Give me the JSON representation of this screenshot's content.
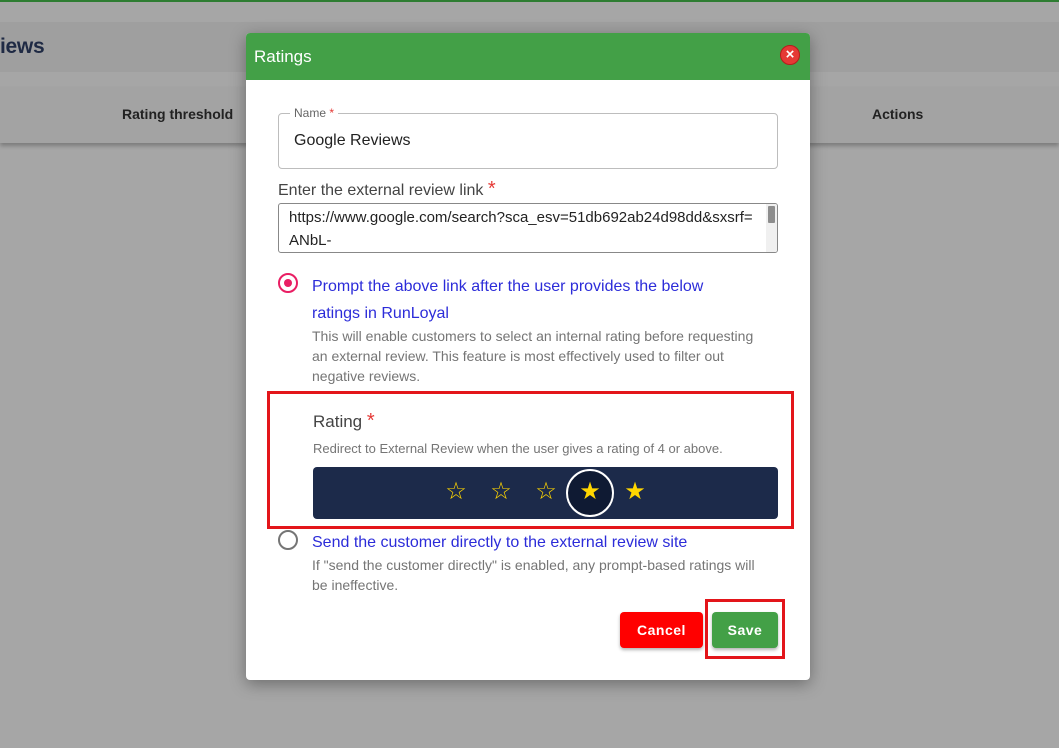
{
  "background": {
    "page_title": "iews",
    "columns": [
      "Rating threshold",
      "Actions"
    ]
  },
  "modal": {
    "title": "Ratings",
    "close_icon": "close-circle-icon",
    "name_field": {
      "label": "Name",
      "required_mark": "*",
      "value": "Google Reviews"
    },
    "link_field": {
      "label": "Enter the external review link",
      "required_mark": "*",
      "value": "https://www.google.com/search?sca_esv=51db692ab24d98dd&sxsrf=ANbL-"
    },
    "option_prompt": {
      "selected": true,
      "label": "Prompt the above link after the user provides the below ratings in RunLoyal",
      "description": "This will enable customers to select an internal rating before requesting an external review. This feature is most effectively used to filter out negative reviews."
    },
    "rating": {
      "label": "Rating",
      "required_mark": "*",
      "description": "Redirect to External Review when the user gives a rating of 4 or above.",
      "selected": 4,
      "max": 5,
      "stars": [
        "☆",
        "☆",
        "☆",
        "★",
        "★"
      ]
    },
    "option_direct": {
      "selected": false,
      "label": "Send the customer directly to the external review site",
      "description": "If \"send the customer directly\" is enabled, any prompt-based ratings will be ineffective."
    },
    "buttons": {
      "cancel": "Cancel",
      "save": "Save"
    }
  },
  "colors": {
    "header_green": "#43a047",
    "cancel_red": "#ff0000",
    "star_bar": "#1c2a4a",
    "star_yellow": "#ffd600",
    "link_blue": "#2c2cd9",
    "highlight_red": "#e3151a"
  }
}
